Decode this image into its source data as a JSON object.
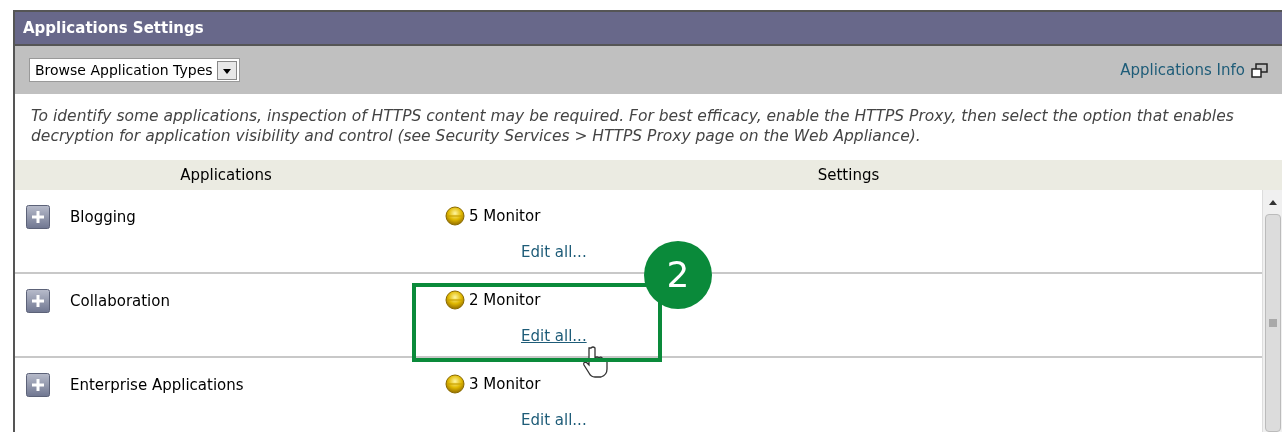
{
  "panel": {
    "title": "Applications Settings"
  },
  "toolbar": {
    "dropdown": "Browse Application Types",
    "info_link": "Applications Info"
  },
  "note": "To identify some applications, inspection of HTTPS content may be required. For best efficacy, enable the HTTPS Proxy, then select the option that enables decryption for application visibility and control (see Security Services > HTTPS Proxy page on the Web Appliance).",
  "table": {
    "columns": [
      "Applications",
      "Settings"
    ],
    "rows": [
      {
        "name": "Blogging",
        "expanded": false,
        "setting": "5 Monitor",
        "edit_link": "Edit all...",
        "hovered": false
      },
      {
        "name": "Collaboration",
        "expanded": false,
        "setting": "2 Monitor",
        "edit_link": "Edit all...",
        "hovered": true,
        "callout": "2"
      },
      {
        "name": "Enterprise Applications",
        "expanded": false,
        "setting": "3 Monitor",
        "edit_link": "Edit all...",
        "hovered": false
      }
    ]
  }
}
